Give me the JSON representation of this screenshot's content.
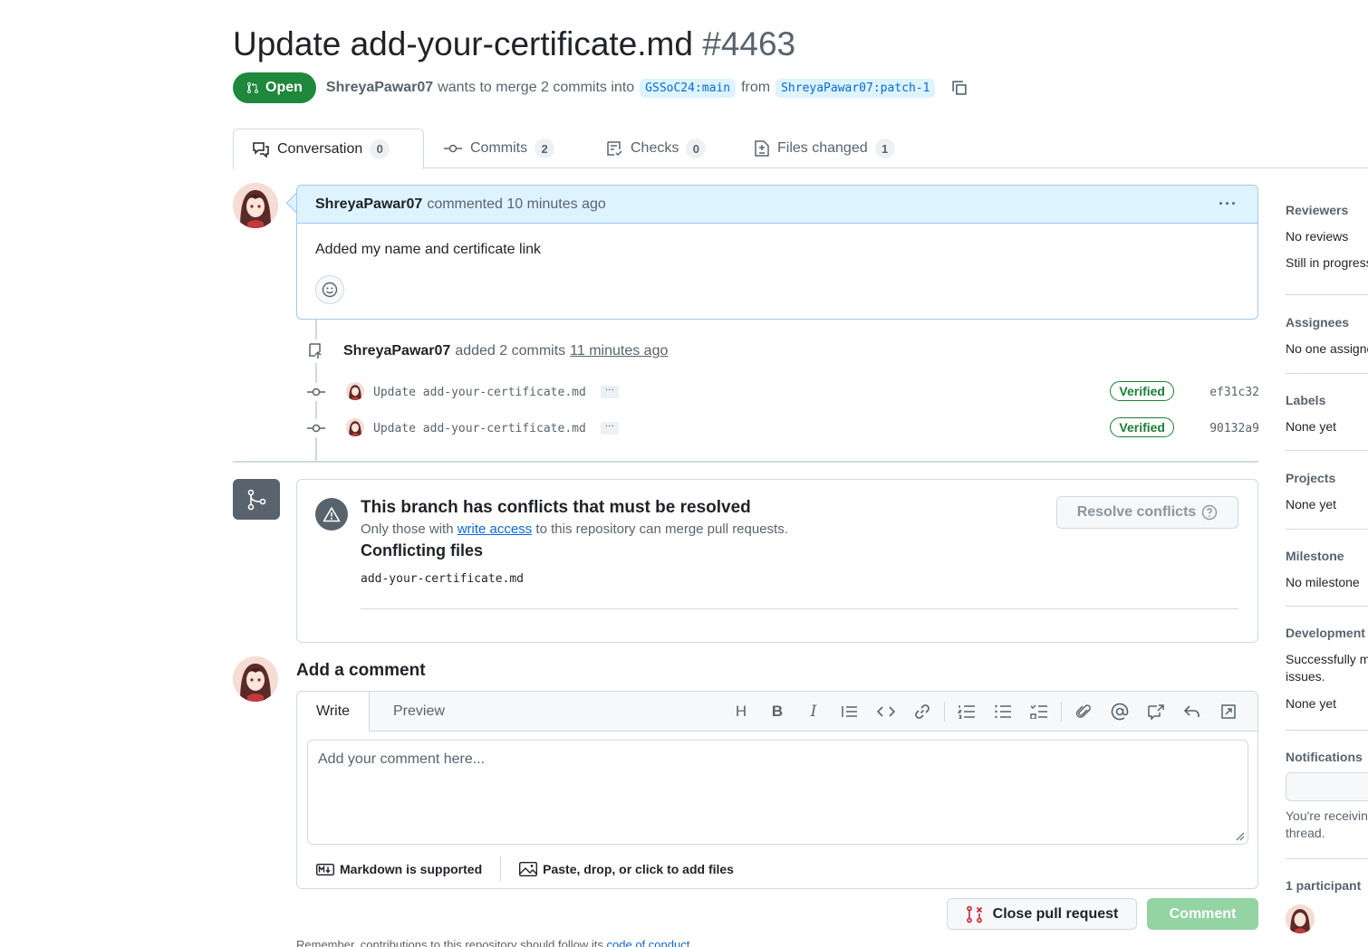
{
  "header": {
    "title": "Update add-your-certificate.md",
    "number": "#4463",
    "state": "Open",
    "author": "ShreyaPawar07",
    "merge_text": "wants to merge 2 commits into",
    "base_branch": "GSSoC24:main",
    "from_text": "from",
    "head_branch": "ShreyaPawar07:patch-1"
  },
  "tabs": [
    {
      "label": "Conversation",
      "count": "0"
    },
    {
      "label": "Commits",
      "count": "2"
    },
    {
      "label": "Checks",
      "count": "0"
    },
    {
      "label": "Files changed",
      "count": "1"
    }
  ],
  "comment": {
    "author": "ShreyaPawar07",
    "meta": "commented 10 minutes ago",
    "body": "Added my name and certificate link"
  },
  "commits_event": {
    "author": "ShreyaPawar07",
    "text": "added 2 commits",
    "time": "11 minutes ago",
    "commits": [
      {
        "message": "Update add-your-certificate.md",
        "badge": "Verified",
        "sha": "ef31c32"
      },
      {
        "message": "Update add-your-certificate.md",
        "badge": "Verified",
        "sha": "90132a9"
      }
    ]
  },
  "merge": {
    "title": "This branch has conflicts that must be resolved",
    "sub_before": "Only those with",
    "sub_link": "write access",
    "sub_after": "to this repository can merge pull requests.",
    "conflicting_title": "Conflicting files",
    "file": "add-your-certificate.md",
    "resolve_label": "Resolve conflicts"
  },
  "add_comment": {
    "title": "Add a comment",
    "tab_write": "Write",
    "tab_preview": "Preview",
    "placeholder": "Add your comment here...",
    "markdown_note": "Markdown is supported",
    "files_note": "Paste, drop, or click to add files",
    "close_label": "Close pull request",
    "comment_label": "Comment",
    "remember_before": "Remember, contributions to this repository should follow its",
    "remember_link": "code of conduct"
  },
  "sidebar": {
    "reviewers_head": "Reviewers",
    "reviewers_val": "No reviews",
    "reviewers_sub": "Still in progress?",
    "assignees_head": "Assignees",
    "assignees_val": "No one assigned",
    "labels_head": "Labels",
    "labels_val": "None yet",
    "projects_head": "Projects",
    "projects_val": "None yet",
    "milestone_head": "Milestone",
    "milestone_val": "No milestone",
    "development_head": "Development",
    "development_val1": "Successfully merging this pull request may close these",
    "development_val2": "issues.",
    "development_val3": "None yet",
    "notifications_head": "Notifications",
    "notifications_note1": "You're receiving notifications because you authored the",
    "notifications_note2": "thread.",
    "participants_head": "1 participant"
  },
  "colors": {
    "open": "#1f883d",
    "link": "#0969da",
    "verified": "#1a7f37",
    "comment_disabled": "#94d3a2"
  }
}
